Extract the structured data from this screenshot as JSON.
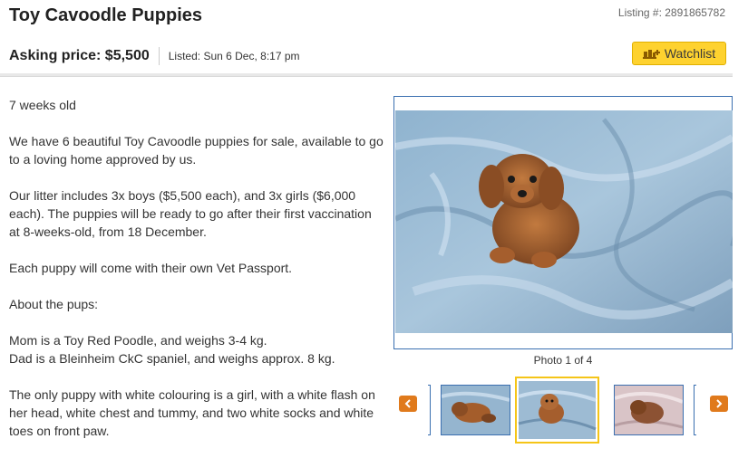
{
  "listing": {
    "title": "Toy Cavoodle Puppies",
    "listing_number": "Listing #: 2891865782",
    "asking_price": "Asking price: $5,500",
    "listed": "Listed: Sun 6 Dec, 8:17 pm",
    "watchlist_label": "Watchlist"
  },
  "description": [
    "7 weeks old",
    "We have 6 beautiful Toy Cavoodle puppies for sale, available to go to a loving home approved by us.",
    "Our litter includes 3x boys ($5,500 each), and 3x girls ($6,000 each). The puppies will be ready to go after their first vaccination at 8-weeks-old, from 18 December.",
    "Each puppy will come with their own Vet Passport.",
    "About the pups:",
    "Mom is a Toy Red Poodle, and weighs 3-4 kg.",
    "Dad is a Bleinheim CkC spaniel, and weighs approx. 8 kg.",
    "The only puppy with white colouring is a girl, with a white flash on her head, white chest and tummy, and two white socks and white toes on front paw."
  ],
  "gallery": {
    "caption": "Photo 1 of 4",
    "prev_icon": "chevron-left-icon",
    "next_icon": "chevron-right-icon"
  },
  "colors": {
    "accent": "#fed22f",
    "nav": "#e07a1c",
    "border": "#3a6fb0",
    "selected": "#f5c518"
  }
}
